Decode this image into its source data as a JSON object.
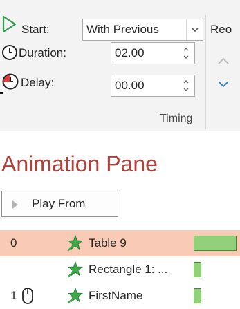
{
  "ribbon": {
    "start_label": "Start:",
    "start_value": "With Previous",
    "duration_label": "Duration:",
    "duration_value": "02.00",
    "delay_label": "Delay:",
    "delay_value": "00.00",
    "group_label": "Timing",
    "reorder_label": "Reo"
  },
  "pane": {
    "title": "Animation Pane",
    "play_label": "Play From",
    "items": [
      {
        "index": "0",
        "name": "Table 9",
        "selected": true,
        "bar_level": 1.0
      },
      {
        "index": "",
        "name": "Rectangle 1: ...",
        "selected": false,
        "bar_level": 0.15
      },
      {
        "index": "1",
        "name": "FirstName",
        "selected": false,
        "bar_level": 0.15
      }
    ]
  },
  "colors": {
    "accent": "#b2403a",
    "selected_row": "#f9cbb6",
    "bar_fill": "#92d07a",
    "play_green": "#2f9e4f",
    "reorder_blue": "#2a73c8"
  }
}
